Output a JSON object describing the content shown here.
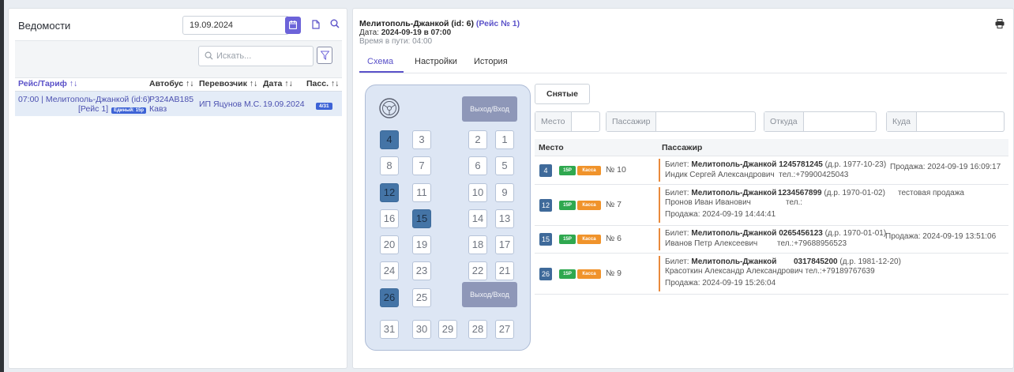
{
  "left_panel": {
    "title": "Ведомости",
    "date_value": "19.09.2024",
    "search_placeholder": "Искать...",
    "columns": {
      "route": "Рейс/Тариф ↑↓",
      "bus": "Автобус ↑↓",
      "carrier": "Перевозчик ↑↓",
      "date": "Дата ↑↓",
      "pass": "Пасс. ↑↓"
    },
    "row": {
      "route_line1": "07:00 | Мелитополь-Джанкой (id:6)",
      "route_line2": "[Рейс 1]",
      "tarif_badge": "Единый: 15р",
      "bus_line1": "Р324АВ185",
      "bus_line2": "Кавз",
      "carrier": "ИП Яцунов М.С.",
      "date": "19.09.2024",
      "pass_badge": "4/31"
    }
  },
  "right_panel": {
    "title": "Мелитополь-Джанкой (id: 6)",
    "title_route_no": "(Рейс № 1)",
    "date_label": "Дата:",
    "date_value": "2024-09-19 в 07:00",
    "travel_time": "Время в пути: 04:00",
    "tabs": [
      {
        "label": "Схема"
      },
      {
        "label": "Настройки"
      },
      {
        "label": "История"
      }
    ]
  },
  "bus": {
    "exit_label": "Выход/Вход",
    "seats": [
      {
        "n": "4",
        "taken": true
      },
      {
        "n": "3",
        "taken": false
      },
      {
        "n": "2",
        "taken": false
      },
      {
        "n": "1",
        "taken": false
      },
      {
        "n": "8",
        "taken": false
      },
      {
        "n": "7",
        "taken": false
      },
      {
        "n": "6",
        "taken": false
      },
      {
        "n": "5",
        "taken": false
      },
      {
        "n": "12",
        "taken": true
      },
      {
        "n": "11",
        "taken": false
      },
      {
        "n": "10",
        "taken": false
      },
      {
        "n": "9",
        "taken": false
      },
      {
        "n": "16",
        "taken": false
      },
      {
        "n": "15",
        "taken": true
      },
      {
        "n": "14",
        "taken": false
      },
      {
        "n": "13",
        "taken": false
      },
      {
        "n": "20",
        "taken": false
      },
      {
        "n": "19",
        "taken": false
      },
      {
        "n": "18",
        "taken": false
      },
      {
        "n": "17",
        "taken": false
      },
      {
        "n": "24",
        "taken": false
      },
      {
        "n": "23",
        "taken": false
      },
      {
        "n": "22",
        "taken": false
      },
      {
        "n": "21",
        "taken": false
      },
      {
        "n": "26",
        "taken": true
      },
      {
        "n": "25",
        "taken": false
      },
      {
        "n": "31",
        "taken": false
      },
      {
        "n": "30",
        "taken": false
      },
      {
        "n": "29",
        "taken": false
      },
      {
        "n": "28",
        "taken": false
      },
      {
        "n": "27",
        "taken": false
      }
    ]
  },
  "passengers": {
    "removed_button": "Снятые",
    "filters": {
      "seat": "Место",
      "passenger": "Пассажир",
      "from": "Откуда",
      "to": "Куда"
    },
    "headers": {
      "seat": "Место",
      "passenger": "Пассажир"
    },
    "tarif_badge": "15Р",
    "kassa_badge": "Касса",
    "ticket_label": "Билет:",
    "route": "Мелитополь-Джанкой",
    "rows": [
      {
        "seat": "4",
        "ticket_no": "№ 10",
        "ticket_id": "1245781245",
        "birth": "(д.р. 1977-10-23)",
        "name": "Индик Сергей Александрович",
        "phone": "тел.:+79900425043",
        "sale": "Продажа: 2024-09-19 16:09:17"
      },
      {
        "seat": "12",
        "ticket_no": "№ 7",
        "ticket_id": "1234567899",
        "birth": "(д.р. 1970-01-02)",
        "name": "Пронов Иван Иванович",
        "phone": "тел.:",
        "note": "тестовая продажа",
        "sale": "Продажа: 2024-09-19 14:44:41"
      },
      {
        "seat": "15",
        "ticket_no": "№ 6",
        "ticket_id": "0265456123",
        "birth": "(д.р. 1970-01-01)",
        "name": "Иванов Петр Алексеевич",
        "phone": "тел.:+79688956523",
        "sale": "Продажа: 2024-09-19 13:51:06"
      },
      {
        "seat": "26",
        "ticket_no": "№ 9",
        "ticket_id": "0317845200",
        "birth": "(д.р. 1981-12-20)",
        "name": "Красоткин Александр Александрович",
        "phone": "тел.:+79189767639",
        "sale": "Продажа: 2024-09-19 15:26:04"
      }
    ]
  }
}
